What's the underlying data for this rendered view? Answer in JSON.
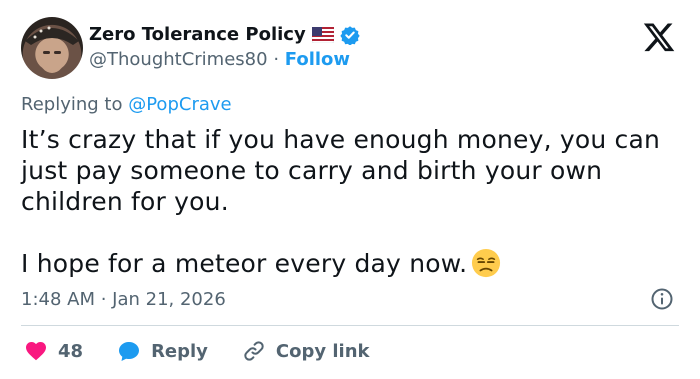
{
  "author": {
    "name": "Zero Tolerance Policy",
    "handle": "@ThoughtCrimes80",
    "separator": "·",
    "follow_label": "Follow"
  },
  "reply_context": {
    "prefix": "Replying to",
    "mention": "@PopCrave"
  },
  "tweet": {
    "text": "It’s crazy that if you have enough money, you can\njust pay someone to carry and birth your own\nchildren for you.\n\nI hope for a meteor every day now."
  },
  "timestamp": "1:48 AM · Jan 21, 2026",
  "actions": {
    "like_count": "48",
    "reply_label": "Reply",
    "copy_link_label": "Copy link"
  },
  "colors": {
    "accent": "#1d9bf0",
    "like": "#f91880",
    "text": "#0f1419",
    "muted": "#536471",
    "divider": "#cfd9de"
  },
  "icons": [
    "avatar",
    "us-flag-icon",
    "verified-badge-icon",
    "x-logo-icon",
    "unamused-face-emoji",
    "info-icon",
    "heart-icon",
    "reply-bubble-icon",
    "link-icon"
  ]
}
